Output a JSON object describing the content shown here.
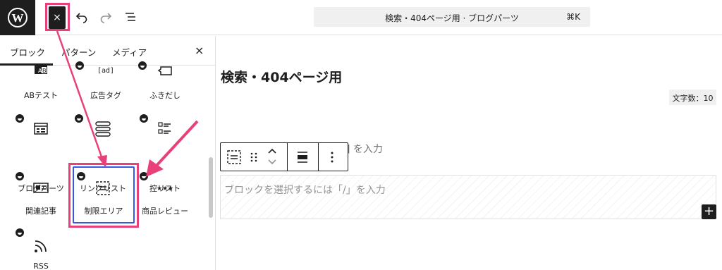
{
  "topbar": {
    "close_label": "×",
    "command_title": "検索・404ページ用 · ブログパーツ",
    "command_shortcut": "⌘K",
    "icons": [
      "wordpress-icon",
      "close-icon",
      "undo-icon",
      "redo-icon",
      "list-view-icon"
    ]
  },
  "sidebar": {
    "tabs": [
      {
        "label": "ブロック",
        "active": true
      },
      {
        "label": "パターン",
        "active": false
      },
      {
        "label": "メディア",
        "active": false
      }
    ],
    "close_label": "×",
    "blocks": [
      {
        "label": "ABテスト",
        "icon": "ab-test-icon",
        "badge": false
      },
      {
        "label": "広告タグ",
        "icon": "ad-tag-icon",
        "badge": true
      },
      {
        "label": "ふきだし",
        "icon": "speech-bubble-icon",
        "badge": true
      },
      {
        "label": "ブログパーツ",
        "icon": "blog-parts-icon",
        "badge": true
      },
      {
        "label": "リンクリスト",
        "icon": "link-list-icon",
        "badge": true
      },
      {
        "label": "控リスト",
        "icon": "check-list-icon",
        "badge": true
      },
      {
        "label": "関連記事",
        "icon": "related-posts-icon",
        "badge": true
      },
      {
        "label": "制限エリア",
        "icon": "restricted-area-icon",
        "badge": true,
        "selected": true
      },
      {
        "label": "商品レビュー",
        "icon": "product-review-icon",
        "badge": true
      },
      {
        "label": "RSS",
        "icon": "rss-icon",
        "badge": true
      }
    ]
  },
  "editor": {
    "title": "検索・404ページ用",
    "char_count": "文字数：10",
    "partial_text": "] を入力",
    "placeholder": "ブロックを選択するには「/」を入力",
    "add_block_label": "+"
  },
  "colors": {
    "annotation": "#e8407b",
    "selection": "#3858e9",
    "dark": "#1e1e1e"
  }
}
